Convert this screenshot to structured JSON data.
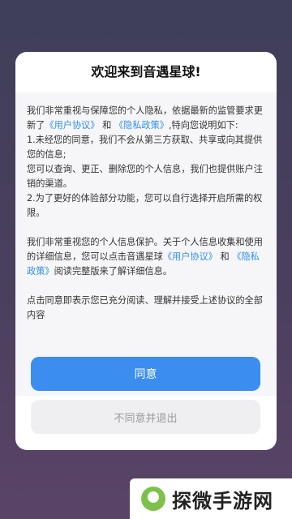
{
  "dialog": {
    "title": "欢迎来到音遇星球!",
    "body": {
      "p1_pre": "我们非常重视与保障您的个人隐私，依据最新的监管要求更新了",
      "link_user_agreement": "《用户协议》",
      "p1_and": "和",
      "link_privacy_policy": "《隐私政策》",
      "p1_post": ",特向您说明如下:",
      "p1_line1": "1.未经您的同意，我们不会从第三方获取、共享或向其提供您的信息;",
      "p1_line2": "您可以查询、更正、删除您的个人信息，我们也提供账户注销的渠道。",
      "p1_line3": "2.为了更好的体验部分功能，您可以自行选择开启所需的权限。",
      "p2_pre": "我们非常重视您的个人信息保护。关于个人信息收集和使用的详细信息，您可以点击音遇星球",
      "p2_and": "和",
      "p2_post": "阅读完整版来了解详细信息。",
      "p3": "点击同意即表示您已充分阅读、理解并接受上述协议的全部内容"
    },
    "agree_label": "同意",
    "disagree_label": "不同意并退出"
  },
  "watermark": {
    "text": "探微手游网",
    "icon": "leaf-logo-icon"
  },
  "colors": {
    "accent": "#3b8ef0",
    "link": "#2f8fef"
  }
}
